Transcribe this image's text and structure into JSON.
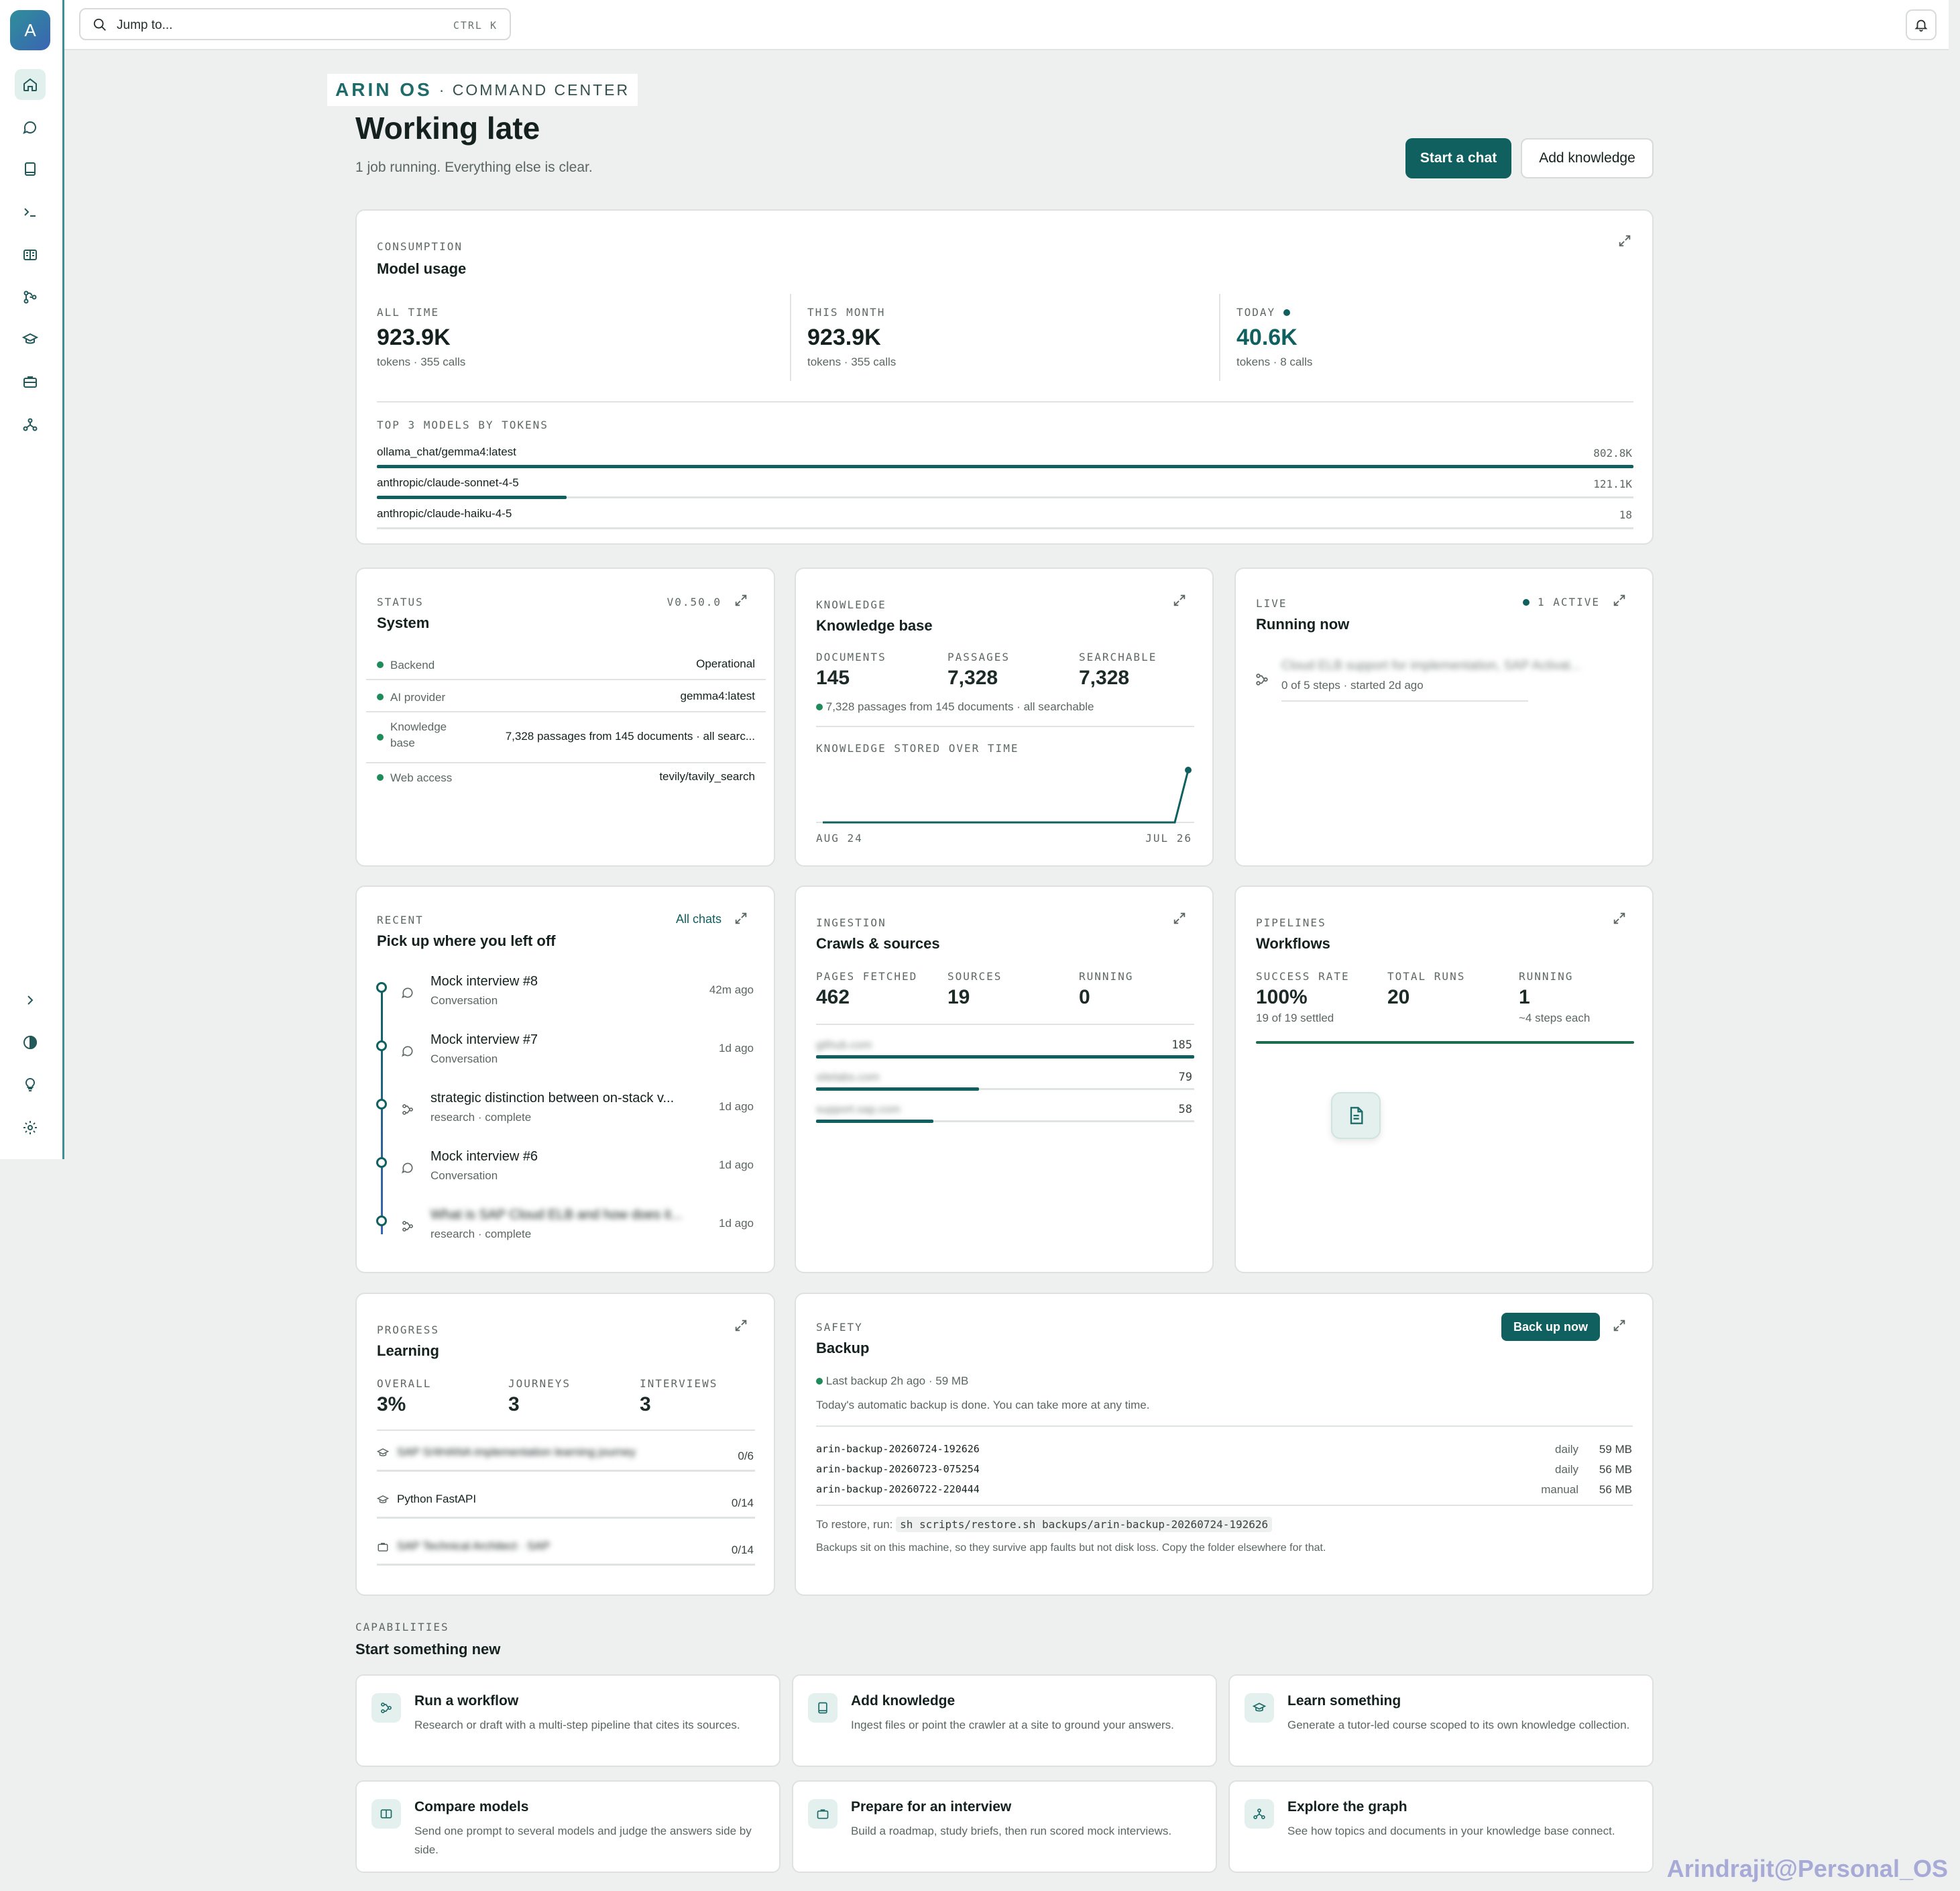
{
  "sidebar": {
    "avatar_letter": "A"
  },
  "search": {
    "placeholder": "Jump to...",
    "shortcut": "CTRL K"
  },
  "header": {
    "brand_name": "ARIN OS",
    "brand_sub": "· COMMAND CENTER",
    "title": "Working late",
    "subtitle": "1 job running. Everything else is clear.",
    "primary_button": "Start a chat",
    "secondary_button": "Add knowledge"
  },
  "usage": {
    "eyebrow": "CONSUMPTION",
    "title": "Model usage",
    "stats": [
      {
        "label": "ALL TIME",
        "value": "923.9K",
        "sub": "tokens · 355 calls"
      },
      {
        "label": "THIS MONTH",
        "value": "923.9K",
        "sub": "tokens · 355 calls"
      },
      {
        "label": "TODAY",
        "value": "40.6K",
        "sub": "tokens · 8 calls"
      }
    ],
    "models_label": "TOP 3 MODELS BY TOKENS",
    "models": [
      {
        "name": "ollama_chat/gemma4:latest",
        "value": "802.8K",
        "fraction": 1.0
      },
      {
        "name": "anthropic/claude-sonnet-4-5",
        "value": "121.1K",
        "fraction": 0.151
      },
      {
        "name": "anthropic/claude-haiku-4-5",
        "value": "18",
        "fraction": 0.0
      }
    ]
  },
  "system": {
    "eyebrow": "STATUS",
    "title": "System",
    "version": "V0.50.0",
    "rows": [
      {
        "label": "Backend",
        "value": "Operational"
      },
      {
        "label": "AI provider",
        "value": "gemma4:latest"
      },
      {
        "label": "Knowledge base",
        "value": "7,328 passages from 145 documents · all searc..."
      },
      {
        "label": "Web access",
        "value": "tevily/tavily_search"
      }
    ]
  },
  "knowledge": {
    "eyebrow": "KNOWLEDGE",
    "title": "Knowledge base",
    "stats": [
      {
        "label": "DOCUMENTS",
        "value": "145"
      },
      {
        "label": "PASSAGES",
        "value": "7,328"
      },
      {
        "label": "SEARCHABLE",
        "value": "7,328"
      }
    ],
    "note": "7,328 passages from 145 documents · all searchable",
    "chart_label": "KNOWLEDGE STORED OVER TIME",
    "x_start": "AUG 24",
    "x_end": "JUL 26"
  },
  "live": {
    "eyebrow": "LIVE",
    "title": "Running now",
    "active": "1 ACTIVE",
    "job_title": "Cloud ELB support for implementation, SAP Activat...",
    "job_sub": "0 of 5 steps · started 2d ago"
  },
  "recent": {
    "eyebrow": "RECENT",
    "title": "Pick up where you left off",
    "link": "All chats",
    "items": [
      {
        "title": "Mock interview #8",
        "sub": "Conversation",
        "time": "42m ago",
        "kind": "chat"
      },
      {
        "title": "Mock interview #7",
        "sub": "Conversation",
        "time": "1d ago",
        "kind": "chat"
      },
      {
        "title": "strategic distinction between on-stack v...",
        "sub": "research · complete",
        "time": "1d ago",
        "kind": "workflow"
      },
      {
        "title": "Mock interview #6",
        "sub": "Conversation",
        "time": "1d ago",
        "kind": "chat"
      },
      {
        "title": "What is SAP Cloud ELB and how does it...",
        "sub": "research · complete",
        "time": "1d ago",
        "kind": "workflow"
      }
    ]
  },
  "ingestion": {
    "eyebrow": "INGESTION",
    "title": "Crawls & sources",
    "stats": [
      {
        "label": "PAGES FETCHED",
        "value": "462"
      },
      {
        "label": "SOURCES",
        "value": "19"
      },
      {
        "label": "RUNNING",
        "value": "0"
      }
    ],
    "sources": [
      {
        "name": "github.com",
        "value": "185",
        "fraction": 1.0
      },
      {
        "name": "sitelabs.com",
        "value": "79",
        "fraction": 0.43
      },
      {
        "name": "support.sap.com",
        "value": "58",
        "fraction": 0.31
      }
    ]
  },
  "pipelines": {
    "eyebrow": "PIPELINES",
    "title": "Workflows",
    "stats": [
      {
        "label": "SUCCESS RATE",
        "value": "100%",
        "sub": "19 of 19 settled"
      },
      {
        "label": "TOTAL RUNS",
        "value": "20",
        "sub": ""
      },
      {
        "label": "RUNNING",
        "value": "1",
        "sub": "~4 steps each"
      }
    ]
  },
  "learning": {
    "eyebrow": "PROGRESS",
    "title": "Learning",
    "stats": [
      {
        "label": "OVERALL",
        "value": "3%"
      },
      {
        "label": "JOURNEYS",
        "value": "3"
      },
      {
        "label": "INTERVIEWS",
        "value": "3"
      }
    ],
    "items": [
      {
        "name": "SAP S/4HANA implementation learning journey",
        "value": "0/6",
        "blurred": true
      },
      {
        "name": "Python FastAPI",
        "value": "0/14",
        "blurred": false
      },
      {
        "name": "SAP Technical Architect · SAP",
        "value": "0/14",
        "blurred": true
      }
    ]
  },
  "backup": {
    "eyebrow": "SAFETY",
    "title": "Backup",
    "button": "Back up now",
    "status": "Last backup 2h ago · 59 MB",
    "note": "Today's automatic backup is done. You can take more at any time.",
    "files": [
      {
        "name": "arin-backup-20260724-192626",
        "kind": "daily",
        "size": "59 MB"
      },
      {
        "name": "arin-backup-20260723-075254",
        "kind": "daily",
        "size": "56 MB"
      },
      {
        "name": "arin-backup-20260722-220444",
        "kind": "manual",
        "size": "56 MB"
      }
    ],
    "restore_prefix": "To restore, run:",
    "restore_cmd": "sh scripts/restore.sh backups/arin-backup-20260724-192626",
    "footer": "Backups sit on this machine, so they survive app faults but not disk loss. Copy the folder elsewhere for that."
  },
  "capabilities": {
    "eyebrow": "CAPABILITIES",
    "title": "Start something new",
    "items": [
      {
        "title": "Run a workflow",
        "desc": "Research or draft with a multi-step pipeline that cites its sources."
      },
      {
        "title": "Add knowledge",
        "desc": "Ingest files or point the crawler at a site to ground your answers."
      },
      {
        "title": "Learn something",
        "desc": "Generate a tutor-led course scoped to its own knowledge collection."
      },
      {
        "title": "Compare models",
        "desc": "Send one prompt to several models and judge the answers side by side."
      },
      {
        "title": "Prepare for an interview",
        "desc": "Build a roadmap, study briefs, then run scored mock interviews."
      },
      {
        "title": "Explore the graph",
        "desc": "See how topics and documents in your knowledge base connect."
      }
    ]
  },
  "watermark": "Arindrajit@Personal_OS",
  "colors": {
    "accent": "#10605f",
    "status_green": "#1f8a5a",
    "sidebar_edge": "#3d8f9a"
  }
}
